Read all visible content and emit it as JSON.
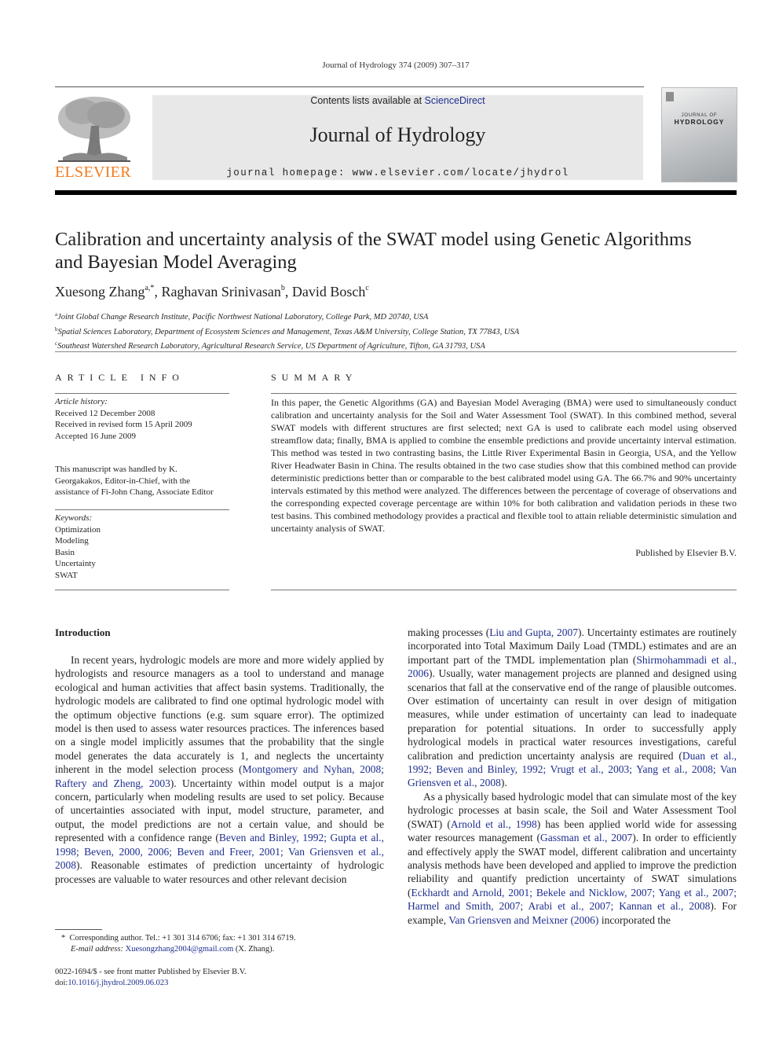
{
  "running_head": "Journal of Hydrology 374 (2009) 307–317",
  "header": {
    "contents_prefix": "Contents lists available at ",
    "contents_link": "ScienceDirect",
    "journal_title": "Journal of Hydrology",
    "homepage": "journal homepage: www.elsevier.com/locate/jhydrol",
    "publisher_logo_text": "ELSEVIER",
    "cover_line1": "JOURNAL OF",
    "cover_line2": "HYDROLOGY",
    "colors": {
      "elsevier_orange": "#f47b20",
      "link_blue": "#1f2f8f",
      "banner_gray": "#e8e8e8"
    }
  },
  "article": {
    "title_line1": "Calibration and uncertainty analysis of the SWAT model using Genetic Algorithms",
    "title_line2": "and Bayesian Model Averaging",
    "authors": [
      {
        "name": "Xuesong Zhang",
        "sup": "a,*",
        "sep": ", "
      },
      {
        "name": "Raghavan Srinivasan",
        "sup": "b",
        "sep": ", "
      },
      {
        "name": "David Bosch",
        "sup": "c",
        "sep": ""
      }
    ],
    "affiliations": [
      {
        "sup": "a",
        "text": "Joint Global Change Research Institute, Pacific Northwest National Laboratory, College Park, MD 20740, USA"
      },
      {
        "sup": "b",
        "text": "Spatial Sciences Laboratory, Department of Ecosystem Sciences and Management, Texas A&M University, College Station, TX 77843, USA"
      },
      {
        "sup": "c",
        "text": "Southeast Watershed Research Laboratory, Agricultural Research Service, US Department of Agriculture, Tifton, GA 31793, USA"
      }
    ]
  },
  "article_info": {
    "heading": "ARTICLE INFO",
    "history_label": "Article history:",
    "received": "Received 12 December 2008",
    "revised": "Received in revised form 15 April 2009",
    "accepted": "Accepted 16 June 2009",
    "handled_line1": "This manuscript was handled by K.",
    "handled_line2": "Georgakakos, Editor-in-Chief, with the",
    "handled_line3": "assistance of Fi-John Chang, Associate Editor",
    "keywords_label": "Keywords:",
    "keywords": [
      "Optimization",
      "Modeling",
      "Basin",
      "Uncertainty",
      "SWAT"
    ]
  },
  "summary": {
    "heading": "SUMMARY",
    "text": "In this paper, the Genetic Algorithms (GA) and Bayesian Model Averaging (BMA) were used to simultaneously conduct calibration and uncertainty analysis for the Soil and Water Assessment Tool (SWAT). In this combined method, several SWAT models with different structures are first selected; next GA is used to calibrate each model using observed streamflow data; finally, BMA is applied to combine the ensemble predictions and provide uncertainty interval estimation. This method was tested in two contrasting basins, the Little River Experimental Basin in Georgia, USA, and the Yellow River Headwater Basin in China. The results obtained in the two case studies show that this combined method can provide deterministic predictions better than or comparable to the best calibrated model using GA. The 66.7% and 90% uncertainty intervals estimated by this method were analyzed. The differences between the percentage of coverage of observations and the corresponding expected coverage percentage are within 10% for both calibration and validation periods in these two test basins. This combined methodology provides a practical and flexible tool to attain reliable deterministic simulation and uncertainty analysis of SWAT.",
    "published": "Published by Elsevier B.V."
  },
  "introduction": {
    "heading": "Introduction",
    "left_p1_a": "In recent years, hydrologic models are more and more widely applied by hydrologists and resource managers as a tool to understand and manage ecological and human activities that affect basin systems. Traditionally, the hydrologic models are calibrated to find one optimal hydrologic model with the optimum objective functions (e.g. sum square error). The optimized model is then used to assess water resources practices. The inferences based on a single model implicitly assumes that the probability that the single model generates the data accurately is 1, and neglects the uncertainty inherent in the model selection process (",
    "left_cite1": "Montgomery and Nyhan, 2008; Raftery and Zheng, 2003",
    "left_p1_b": "). Uncertainty within model output is a major concern, particularly when modeling results are used to set policy. Because of uncertainties associated with input, model structure, parameter, and output, the model predictions are not a certain value, and should be represented with a confidence range (",
    "left_cite2": "Beven and Binley, 1992; Gupta et al., 1998; Beven, 2000, 2006; Beven and Freer, 2001; Van Griensven et al., 2008",
    "left_p1_c": "). Reasonable estimates of prediction uncertainty of hydrologic processes are valuable to water resources and other relevant decision",
    "right_p1_a": "making processes (",
    "right_cite1": "Liu and Gupta, 2007",
    "right_p1_b": "). Uncertainty estimates are routinely incorporated into Total Maximum Daily Load (TMDL) estimates and are an important part of the TMDL implementation plan (",
    "right_cite2": "Shirmohammadi et al., 2006",
    "right_p1_c": "). Usually, water management projects are planned and designed using scenarios that fall at the conservative end of the range of plausible outcomes. Over estimation of uncertainty can result in over design of mitigation measures, while under estimation of uncertainty can lead to inadequate preparation for potential situations. In order to successfully apply hydrological models in practical water resources investigations, careful calibration and prediction uncertainty analysis are required (",
    "right_cite3": "Duan et al., 1992; Beven and Binley, 1992; Vrugt et al., 2003; Yang et al., 2008; Van Griensven et al., 2008",
    "right_p1_d": ").",
    "right_p2_a": "As a physically based hydrologic model that can simulate most of the key hydrologic processes at basin scale, the Soil and Water Assessment Tool (SWAT) (",
    "right_cite4": "Arnold et al., 1998",
    "right_p2_b": ") has been applied world wide for assessing water resources management (",
    "right_cite5": "Gassman et al., 2007",
    "right_p2_c": "). In order to efficiently and effectively apply the SWAT model, different calibration and uncertainty analysis methods have been developed and applied to improve the prediction reliability and quantify prediction uncertainty of SWAT simulations (",
    "right_cite6": "Eckhardt and Arnold, 2001; Bekele and Nicklow, 2007; Yang et al., 2007; Harmel and Smith, 2007; Arabi et al., 2007; Kannan et al., 2008",
    "right_p2_d": "). For example, ",
    "right_cite7": "Van Griensven and Meixner (2006)",
    "right_p2_e": " incorporated the"
  },
  "footnotes": {
    "corresponding": "Corresponding author. Tel.: +1 301 314 6706; fax: +1 301 314 6719.",
    "email_label": "E-mail address:",
    "email": "Xuesongzhang2004@gmail.com",
    "email_suffix": " (X. Zhang).",
    "issn": "0022-1694/$ - see front matter Published by Elsevier B.V.",
    "doi_label": "doi:",
    "doi": "10.1016/j.jhydrol.2009.06.023"
  }
}
